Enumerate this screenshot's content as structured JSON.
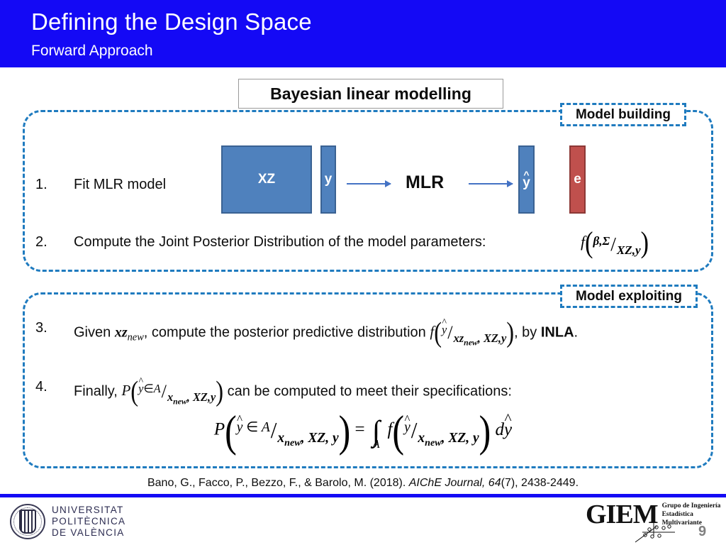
{
  "header": {
    "title": "Defining the Design Space",
    "subtitle": "Forward Approach",
    "bar_color": "#1409F5"
  },
  "section": {
    "title_box": "Bayesian linear modelling",
    "tags": {
      "model_building": "Model building",
      "model_exploiting": "Model exploiting"
    },
    "dash_color": "#1F7BBF"
  },
  "steps": [
    {
      "number": "1.",
      "text": "Fit MLR model"
    },
    {
      "number": "2.",
      "text": "Compute the Joint Posterior Distribution of the model parameters:",
      "formula": "f(β,Σ / XZ,y)"
    },
    {
      "number": "3.",
      "text_before": "Given",
      "term": "xz",
      "term_sub": "new",
      "text_mid": ", compute the posterior predictive distribution",
      "formula": "f(ŷ / xz_new, XZ,y)",
      "text_after": ", by",
      "method": "INLA",
      "text_end": "."
    },
    {
      "number": "4.",
      "text_before": "Finally,",
      "formula": "P(ŷ∈A / x_new, XZ,y)",
      "text_after": "can be computed to meet their specifications:"
    }
  ],
  "diagram": {
    "blocks": [
      {
        "label": "XZ",
        "color": "#4F81BD"
      },
      {
        "label": "y",
        "color": "#4F81BD"
      },
      {
        "label": "ŷ",
        "color": "#4F81BD"
      },
      {
        "label": "e",
        "color": "#C0504D"
      }
    ],
    "center_label": "MLR"
  },
  "display_equation": {
    "p": "P",
    "lhs_num": "ŷ ∈ A",
    "lhs_den": "x_new, XZ, y",
    "equals": "=",
    "integral": "∫",
    "integral_limit": "A",
    "f": "f",
    "rhs_num": "ŷ",
    "rhs_den": "x_new, XZ, y",
    "differential": "dŷ"
  },
  "citation": {
    "authors": "Bano, G., Facco, P., Bezzo, F., & Barolo, M. (2018).",
    "journal": "AIChE Journal, 64",
    "issue": "(7), 2438-2449."
  },
  "footer": {
    "university": [
      "UNIVERSITAT",
      "POLITÈCNICA",
      "DE  VALÈNCIA"
    ],
    "group_acronym": "GIEM",
    "group_name": [
      "Grupo de Ingeniería",
      "Estadística Multivariante"
    ],
    "page_number": "9"
  }
}
